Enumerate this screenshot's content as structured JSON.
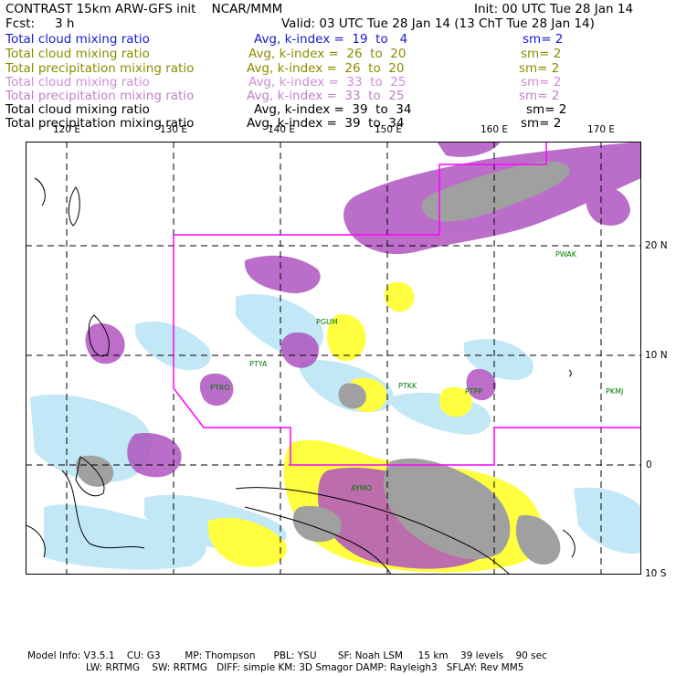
{
  "header": {
    "title": "CONTRAST 15km ARW-GFS init    NCAR/MMM",
    "init": "Init: 00 UTC Tue 28 Jan 14",
    "fcst_label": "Fcst:",
    "fcst_value": "3 h",
    "valid": "Valid: 03 UTC Tue 28 Jan 14 (13 ChT Tue 28 Jan 14)"
  },
  "legend": [
    {
      "field": "Total cloud mixing ratio",
      "avg": "Avg, k-index =  19  to   4",
      "sm": "sm= 2",
      "color": "#1a1ad0"
    },
    {
      "field": "Total cloud mixing ratio",
      "avg": "Avg, k-index =  26  to  20",
      "sm": "sm= 2",
      "color": "#8c8c00"
    },
    {
      "field": "Total precipitation mixing ratio",
      "avg": "Avg, k-index =  26  to  20",
      "sm": "sm= 2",
      "color": "#8c8c00"
    },
    {
      "field": "Total cloud mixing ratio",
      "avg": "Avg, k-index =  33  to  25",
      "sm": "sm= 2",
      "color": "#d08cd8"
    },
    {
      "field": "Total precipitation mixing ratio",
      "avg": "Avg, k-index =  33  to  25",
      "sm": "sm= 2",
      "color": "#c080c8"
    },
    {
      "field": "Total cloud mixing ratio",
      "avg": "Avg, k-index =  39  to  34",
      "sm": "sm= 2",
      "color": "#000000"
    },
    {
      "field": "Total precipitation mixing ratio",
      "avg": "Avg, k-index =  39  to  34",
      "sm": "sm= 2",
      "color": "#000000"
    }
  ],
  "axes": {
    "lon_labels": [
      "120 E",
      "130 E",
      "140 E",
      "150 E",
      "160 E",
      "170 E"
    ],
    "lat_labels": [
      "20 N",
      "10 N",
      "0",
      "10 S"
    ]
  },
  "stations": [
    "PGUM",
    "PTYA",
    "PTRO",
    "PTKK",
    "PTPP",
    "PKMJ",
    "PWAK",
    "AYMO"
  ],
  "colors": {
    "cloud_low": "#bfe6f5",
    "cloud_mid": "#ffff40",
    "cloud_high": "#b055c0",
    "precip_deep": "#a0a0a0",
    "boundary": "#ff00ff",
    "station_label": "#007a00"
  },
  "footer": {
    "line1": "Model Info: V3.5.1    CU: G3        MP: Thompson      PBL: YSU       SF: Noah LSM     15 km    39 levels    90 sec",
    "line2": "LW: RRTMG    SW: RRTMG   DIFF: simple KM: 3D Smagor DAMP: Rayleigh3   SFLAY: Rev MM5"
  }
}
